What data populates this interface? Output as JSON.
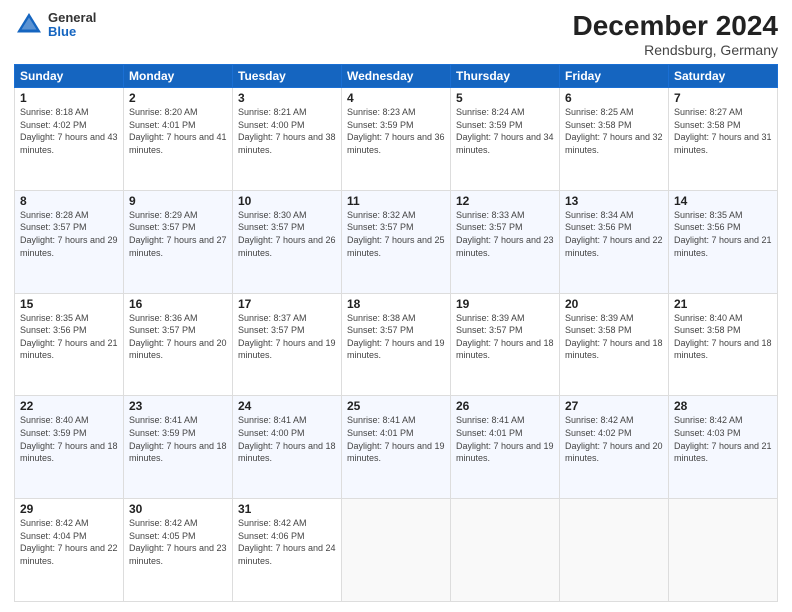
{
  "header": {
    "logo_general": "General",
    "logo_blue": "Blue",
    "title": "December 2024",
    "subtitle": "Rendsburg, Germany"
  },
  "calendar": {
    "days_of_week": [
      "Sunday",
      "Monday",
      "Tuesday",
      "Wednesday",
      "Thursday",
      "Friday",
      "Saturday"
    ],
    "weeks": [
      [
        {
          "day": "1",
          "sunrise": "Sunrise: 8:18 AM",
          "sunset": "Sunset: 4:02 PM",
          "daylight": "Daylight: 7 hours and 43 minutes."
        },
        {
          "day": "2",
          "sunrise": "Sunrise: 8:20 AM",
          "sunset": "Sunset: 4:01 PM",
          "daylight": "Daylight: 7 hours and 41 minutes."
        },
        {
          "day": "3",
          "sunrise": "Sunrise: 8:21 AM",
          "sunset": "Sunset: 4:00 PM",
          "daylight": "Daylight: 7 hours and 38 minutes."
        },
        {
          "day": "4",
          "sunrise": "Sunrise: 8:23 AM",
          "sunset": "Sunset: 3:59 PM",
          "daylight": "Daylight: 7 hours and 36 minutes."
        },
        {
          "day": "5",
          "sunrise": "Sunrise: 8:24 AM",
          "sunset": "Sunset: 3:59 PM",
          "daylight": "Daylight: 7 hours and 34 minutes."
        },
        {
          "day": "6",
          "sunrise": "Sunrise: 8:25 AM",
          "sunset": "Sunset: 3:58 PM",
          "daylight": "Daylight: 7 hours and 32 minutes."
        },
        {
          "day": "7",
          "sunrise": "Sunrise: 8:27 AM",
          "sunset": "Sunset: 3:58 PM",
          "daylight": "Daylight: 7 hours and 31 minutes."
        }
      ],
      [
        {
          "day": "8",
          "sunrise": "Sunrise: 8:28 AM",
          "sunset": "Sunset: 3:57 PM",
          "daylight": "Daylight: 7 hours and 29 minutes."
        },
        {
          "day": "9",
          "sunrise": "Sunrise: 8:29 AM",
          "sunset": "Sunset: 3:57 PM",
          "daylight": "Daylight: 7 hours and 27 minutes."
        },
        {
          "day": "10",
          "sunrise": "Sunrise: 8:30 AM",
          "sunset": "Sunset: 3:57 PM",
          "daylight": "Daylight: 7 hours and 26 minutes."
        },
        {
          "day": "11",
          "sunrise": "Sunrise: 8:32 AM",
          "sunset": "Sunset: 3:57 PM",
          "daylight": "Daylight: 7 hours and 25 minutes."
        },
        {
          "day": "12",
          "sunrise": "Sunrise: 8:33 AM",
          "sunset": "Sunset: 3:57 PM",
          "daylight": "Daylight: 7 hours and 23 minutes."
        },
        {
          "day": "13",
          "sunrise": "Sunrise: 8:34 AM",
          "sunset": "Sunset: 3:56 PM",
          "daylight": "Daylight: 7 hours and 22 minutes."
        },
        {
          "day": "14",
          "sunrise": "Sunrise: 8:35 AM",
          "sunset": "Sunset: 3:56 PM",
          "daylight": "Daylight: 7 hours and 21 minutes."
        }
      ],
      [
        {
          "day": "15",
          "sunrise": "Sunrise: 8:35 AM",
          "sunset": "Sunset: 3:56 PM",
          "daylight": "Daylight: 7 hours and 21 minutes."
        },
        {
          "day": "16",
          "sunrise": "Sunrise: 8:36 AM",
          "sunset": "Sunset: 3:57 PM",
          "daylight": "Daylight: 7 hours and 20 minutes."
        },
        {
          "day": "17",
          "sunrise": "Sunrise: 8:37 AM",
          "sunset": "Sunset: 3:57 PM",
          "daylight": "Daylight: 7 hours and 19 minutes."
        },
        {
          "day": "18",
          "sunrise": "Sunrise: 8:38 AM",
          "sunset": "Sunset: 3:57 PM",
          "daylight": "Daylight: 7 hours and 19 minutes."
        },
        {
          "day": "19",
          "sunrise": "Sunrise: 8:39 AM",
          "sunset": "Sunset: 3:57 PM",
          "daylight": "Daylight: 7 hours and 18 minutes."
        },
        {
          "day": "20",
          "sunrise": "Sunrise: 8:39 AM",
          "sunset": "Sunset: 3:58 PM",
          "daylight": "Daylight: 7 hours and 18 minutes."
        },
        {
          "day": "21",
          "sunrise": "Sunrise: 8:40 AM",
          "sunset": "Sunset: 3:58 PM",
          "daylight": "Daylight: 7 hours and 18 minutes."
        }
      ],
      [
        {
          "day": "22",
          "sunrise": "Sunrise: 8:40 AM",
          "sunset": "Sunset: 3:59 PM",
          "daylight": "Daylight: 7 hours and 18 minutes."
        },
        {
          "day": "23",
          "sunrise": "Sunrise: 8:41 AM",
          "sunset": "Sunset: 3:59 PM",
          "daylight": "Daylight: 7 hours and 18 minutes."
        },
        {
          "day": "24",
          "sunrise": "Sunrise: 8:41 AM",
          "sunset": "Sunset: 4:00 PM",
          "daylight": "Daylight: 7 hours and 18 minutes."
        },
        {
          "day": "25",
          "sunrise": "Sunrise: 8:41 AM",
          "sunset": "Sunset: 4:01 PM",
          "daylight": "Daylight: 7 hours and 19 minutes."
        },
        {
          "day": "26",
          "sunrise": "Sunrise: 8:41 AM",
          "sunset": "Sunset: 4:01 PM",
          "daylight": "Daylight: 7 hours and 19 minutes."
        },
        {
          "day": "27",
          "sunrise": "Sunrise: 8:42 AM",
          "sunset": "Sunset: 4:02 PM",
          "daylight": "Daylight: 7 hours and 20 minutes."
        },
        {
          "day": "28",
          "sunrise": "Sunrise: 8:42 AM",
          "sunset": "Sunset: 4:03 PM",
          "daylight": "Daylight: 7 hours and 21 minutes."
        }
      ],
      [
        {
          "day": "29",
          "sunrise": "Sunrise: 8:42 AM",
          "sunset": "Sunset: 4:04 PM",
          "daylight": "Daylight: 7 hours and 22 minutes."
        },
        {
          "day": "30",
          "sunrise": "Sunrise: 8:42 AM",
          "sunset": "Sunset: 4:05 PM",
          "daylight": "Daylight: 7 hours and 23 minutes."
        },
        {
          "day": "31",
          "sunrise": "Sunrise: 8:42 AM",
          "sunset": "Sunset: 4:06 PM",
          "daylight": "Daylight: 7 hours and 24 minutes."
        },
        null,
        null,
        null,
        null
      ]
    ]
  }
}
